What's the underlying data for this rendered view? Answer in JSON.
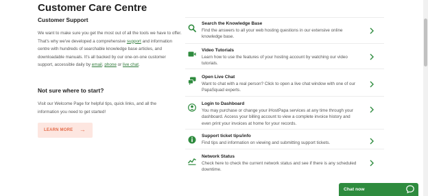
{
  "page": {
    "title": "Customer Care Centre"
  },
  "support": {
    "heading": "Customer Support",
    "text_1": "We want to make sure you get the most out of all the tools we have to offer. That's why we've developed a comprehensive ",
    "link_support": "support",
    "text_2": " and information centre with hundreds of searchable knowledge base articles, and downloadable manuals. It's all backed by our one-on-one customer support, accessible daily by ",
    "link_email": "email",
    "text_3": ", ",
    "link_phone": "phone",
    "text_4": " or ",
    "link_live_chat": "live chat",
    "text_5": "."
  },
  "start": {
    "heading": "Not sure where to start?",
    "text": "Visit our Welcome Page for helpful tips, quick links, and all the information you need to get started!",
    "button_label": "LEARN MORE",
    "button_arrow": "→"
  },
  "cards": [
    {
      "icon": "search-icon",
      "title": "Search the Knowledge Base",
      "desc": "Find the answers to all your web hosting questions in our extensive online knowledge base."
    },
    {
      "icon": "video-icon",
      "title": "Video Tutorials",
      "desc": "Learn how to use the features of your hosting account by watching our video tutorials."
    },
    {
      "icon": "chat-bubbles-icon",
      "title": "Open Live Chat",
      "desc": "Want to chat with a real person? Click to open a live chat window with one of our PapaSquad experts."
    },
    {
      "icon": "user-icon",
      "title": "Login to Dashboard",
      "desc": "You may purchase or change your iHostPapa services at any time through your dashboard. Access your billing account to view a complete invoice history and even print your invoices at home for your records."
    },
    {
      "icon": "info-icon",
      "title": "Support ticket tips/info",
      "desc": "Find tips and information on viewing and submitting support tickets."
    },
    {
      "icon": "network-status-icon",
      "title": "Network Status",
      "desc": "Check here to check the current network status and see if there is any scheduled downtime."
    }
  ],
  "chat_widget": {
    "label": "Chat now"
  },
  "colors": {
    "accent_green": "#2e8b3e",
    "button_bg": "#fde6e0",
    "button_text": "#e36a48"
  }
}
